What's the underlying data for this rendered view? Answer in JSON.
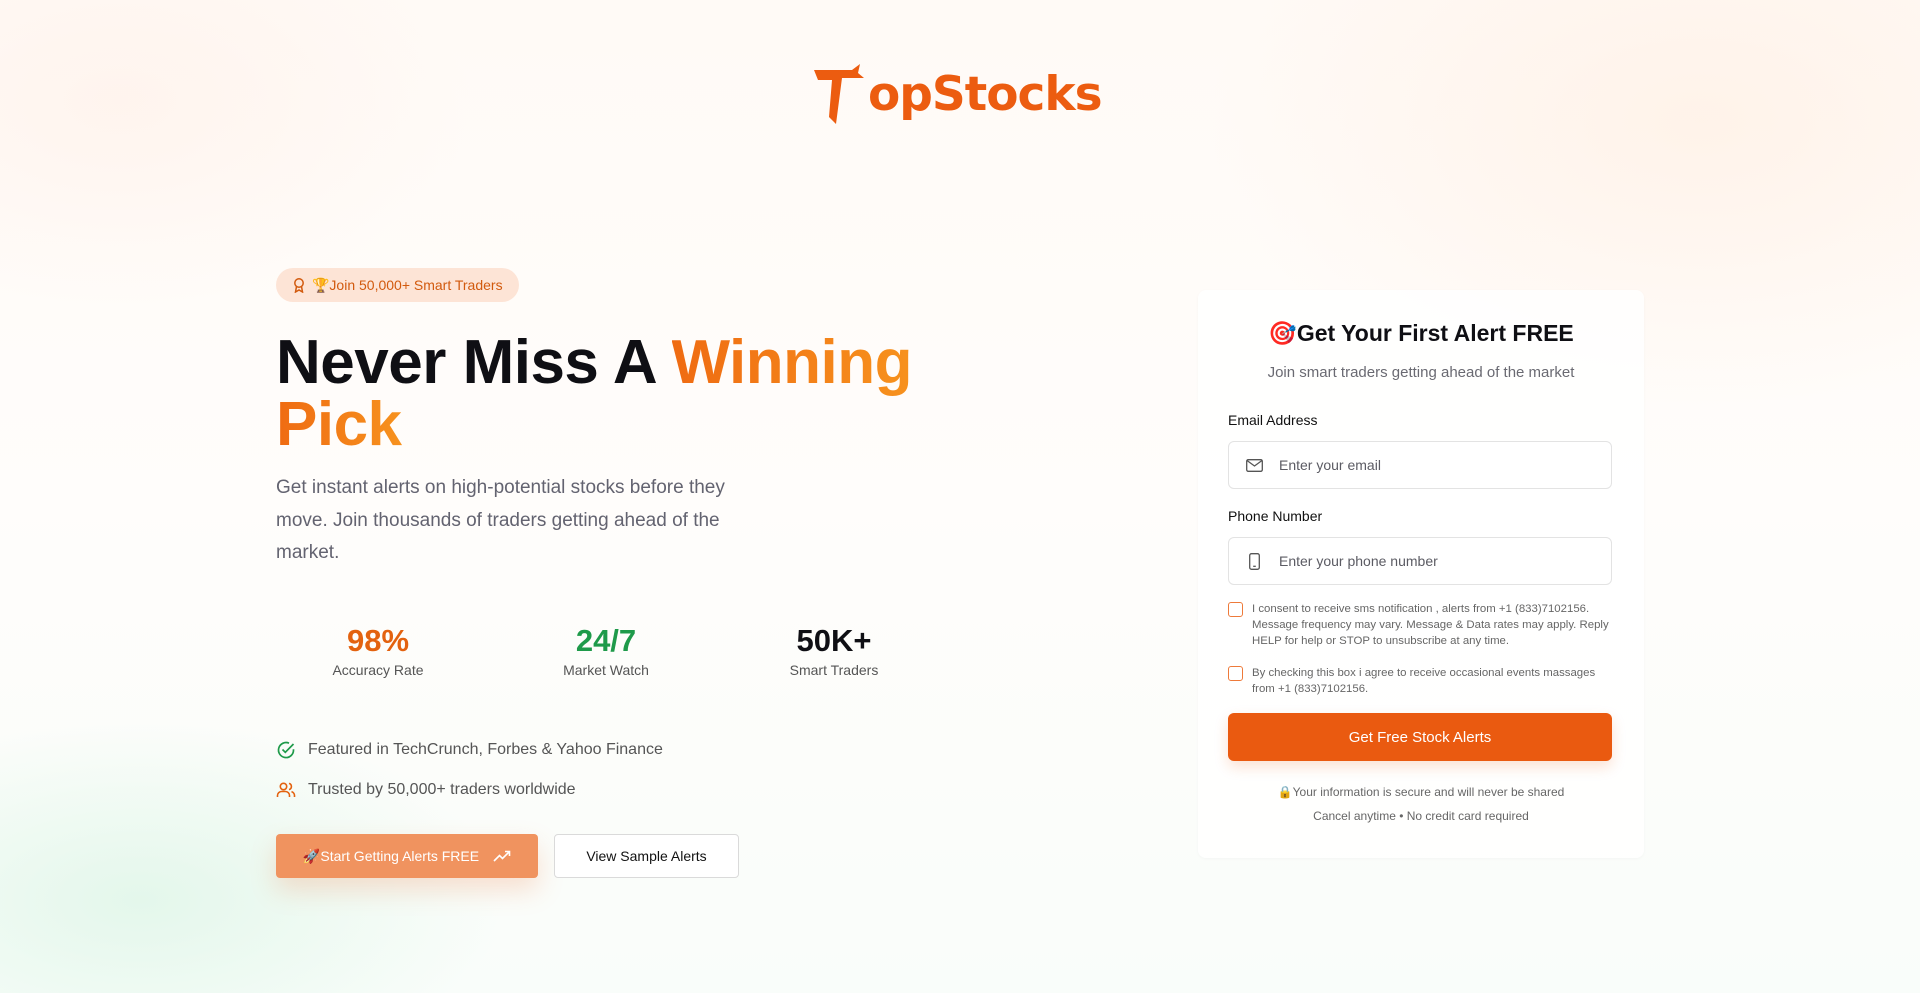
{
  "brand": {
    "name": "opStocks",
    "accent_color": "#ec5c10"
  },
  "hero": {
    "badge": "🏆Join 50,000+ Smart Traders",
    "headline_plain": "Never Miss A ",
    "headline_accent_1": "Winning",
    "headline_accent_2": "Pick",
    "subtext": "Get instant alerts on high-potential stocks before they move. Join thousands of traders getting ahead of the market."
  },
  "stats": [
    {
      "value": "98%",
      "label": "Accuracy Rate",
      "color": "#e3620f"
    },
    {
      "value": "24/7",
      "label": "Market Watch",
      "color": "#1e9a4a"
    },
    {
      "value": "50K+",
      "label": "Smart Traders",
      "color": "#0f0f14"
    }
  ],
  "features": [
    {
      "text": "Featured in TechCrunch, Forbes & Yahoo Finance",
      "icon": "check-circle-icon"
    },
    {
      "text": "Trusted by 50,000+ traders worldwide",
      "icon": "users-icon"
    }
  ],
  "cta": {
    "primary": "🚀Start Getting Alerts FREE",
    "secondary": "View Sample Alerts"
  },
  "form": {
    "title": "🎯Get Your First Alert FREE",
    "subtitle": "Join smart traders getting ahead of the market",
    "email_label": "Email Address",
    "email_placeholder": "Enter your email",
    "phone_label": "Phone Number",
    "phone_placeholder": "Enter your phone number",
    "consent_sms": "I consent to receive sms notification , alerts from +1 (833)7102156. Message frequency may vary. Message & Data rates may apply. Reply HELP for help or STOP to unsubscribe at any time.",
    "consent_events": "By checking this box i agree to receive occasional events massages from +1 (833)7102156.",
    "submit": "Get Free Stock Alerts",
    "secure_note": "🔒Your information is secure and will never be shared",
    "cancel_note": "Cancel anytime • No credit card required"
  }
}
